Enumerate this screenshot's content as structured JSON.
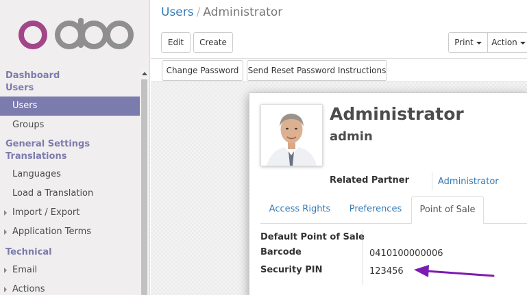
{
  "brand": {
    "logo_text": "odoo",
    "colors": {
      "accent": "#7c7bad",
      "link": "#337ab7",
      "arrow": "#7d1bb0",
      "logo_o": "#a24689",
      "logo_doo": "#8f8f8f"
    }
  },
  "sidebar": {
    "sections": [
      {
        "label": "Dashboard"
      },
      {
        "label": "Users"
      },
      {
        "label": "General Settings"
      },
      {
        "label": "Translations"
      },
      {
        "label": "Technical"
      }
    ],
    "items": [
      {
        "label": "Users",
        "active": true
      },
      {
        "label": "Groups"
      },
      {
        "label": "Languages"
      },
      {
        "label": "Load a Translation"
      },
      {
        "label": "Import / Export",
        "expandable": true
      },
      {
        "label": "Application Terms",
        "expandable": true
      },
      {
        "label": "Email",
        "expandable": true
      },
      {
        "label": "Actions",
        "expandable": true
      }
    ]
  },
  "breadcrumb": {
    "parent": "Users",
    "separator": "/",
    "current": "Administrator"
  },
  "toolbar": {
    "edit": "Edit",
    "create": "Create",
    "print": "Print",
    "action": "Action"
  },
  "statusbar": {
    "change_password": "Change Password",
    "send_reset": "Send Reset Password Instructions"
  },
  "record": {
    "name": "Administrator",
    "login": "admin",
    "related_partner_label": "Related Partner",
    "related_partner_value": "Administrator",
    "avatar_icon": "user-photo-icon"
  },
  "tabs": [
    {
      "label": "Access Rights"
    },
    {
      "label": "Preferences"
    },
    {
      "label": "Point of Sale",
      "active": true
    }
  ],
  "pos_fields": {
    "default_pos_label": "Default Point of Sale",
    "default_pos_value": "",
    "barcode_label": "Barcode",
    "barcode_value": "0410100000006",
    "pin_label": "Security PIN",
    "pin_value": "123456"
  }
}
